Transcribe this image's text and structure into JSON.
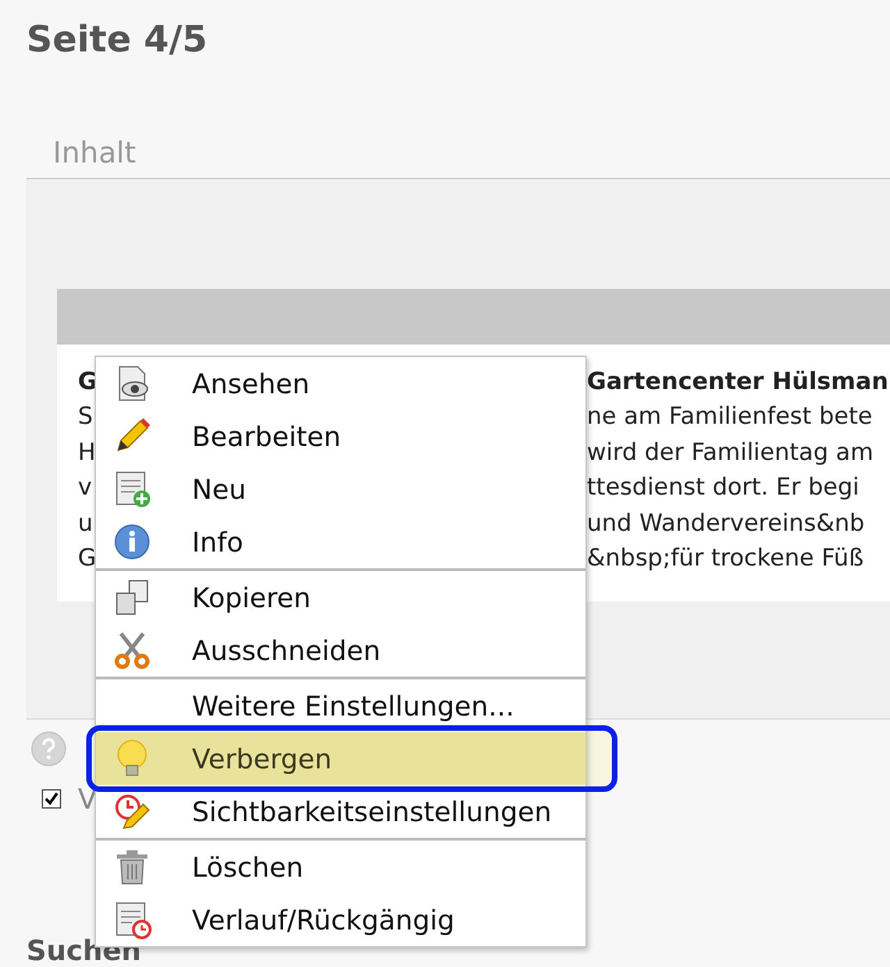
{
  "title": "Seite 4/5",
  "tab": {
    "label": "Inhalt"
  },
  "content_lines": [
    {
      "left": "G",
      "right": "Gartencenter Hülsman",
      "bold": true
    },
    {
      "left": "S",
      "right": "ne am Familienfest bete",
      "bold": false
    },
    {
      "left": "H",
      "right": "wird der Familientag am",
      "bold": false
    },
    {
      "left": "v",
      "right": "ttesdienst dort. Er begi",
      "bold": false
    },
    {
      "left": "u",
      "right": "und Wandervereins&nb",
      "bold": false
    },
    {
      "left": "G",
      "right": "&nbsp;für trockene Füß",
      "bold": false
    }
  ],
  "option": {
    "label": "V",
    "checked": true
  },
  "search_heading": "Suchen",
  "context_menu": {
    "groups": [
      [
        {
          "label": "Ansehen",
          "selected": false
        },
        {
          "label": "Bearbeiten",
          "selected": false
        },
        {
          "label": "Neu",
          "selected": false
        },
        {
          "label": "Info",
          "selected": false
        }
      ],
      [
        {
          "label": "Kopieren",
          "selected": false
        },
        {
          "label": "Ausschneiden",
          "selected": false
        }
      ],
      [
        {
          "label": "Weitere Einstellungen...",
          "selected": false
        },
        {
          "label": "Verbergen",
          "selected": true
        },
        {
          "label": "Sichtbarkeitseinstellungen",
          "selected": false
        }
      ],
      [
        {
          "label": "Löschen",
          "selected": false
        },
        {
          "label": "Verlauf/Rückgängig",
          "selected": false
        }
      ]
    ]
  }
}
